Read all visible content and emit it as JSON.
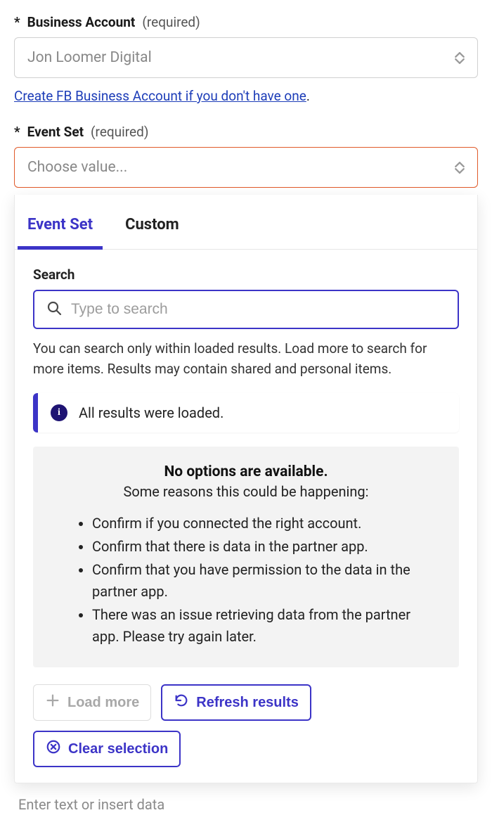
{
  "fields": {
    "business_account": {
      "label": "Business Account",
      "required_tag": "(required)",
      "value": "Jon Loomer Digital"
    },
    "event_set": {
      "label": "Event Set",
      "required_tag": "(required)",
      "placeholder": "Choose value..."
    }
  },
  "links": {
    "create_fb": "Create FB Business Account if you don't have one"
  },
  "dropdown": {
    "tabs": {
      "event_set": "Event Set",
      "custom": "Custom"
    },
    "search": {
      "label": "Search",
      "placeholder": "Type to search"
    },
    "hint": "You can search only within loaded results. Load more to search for more items. Results may contain shared and personal items.",
    "info_banner": "All results were loaded.",
    "no_options": {
      "title": "No options are available.",
      "subtitle": "Some reasons this could be happening:",
      "reasons": [
        "Confirm if you connected the right account.",
        "Confirm that there is data in the partner app.",
        "Confirm that you have permission to the data in the partner app.",
        "There was an issue retrieving data from the partner app. Please try again later."
      ]
    },
    "actions": {
      "load_more": "Load more",
      "refresh": "Refresh results",
      "clear": "Clear selection"
    }
  },
  "footer_cut": "Enter text or insert data"
}
